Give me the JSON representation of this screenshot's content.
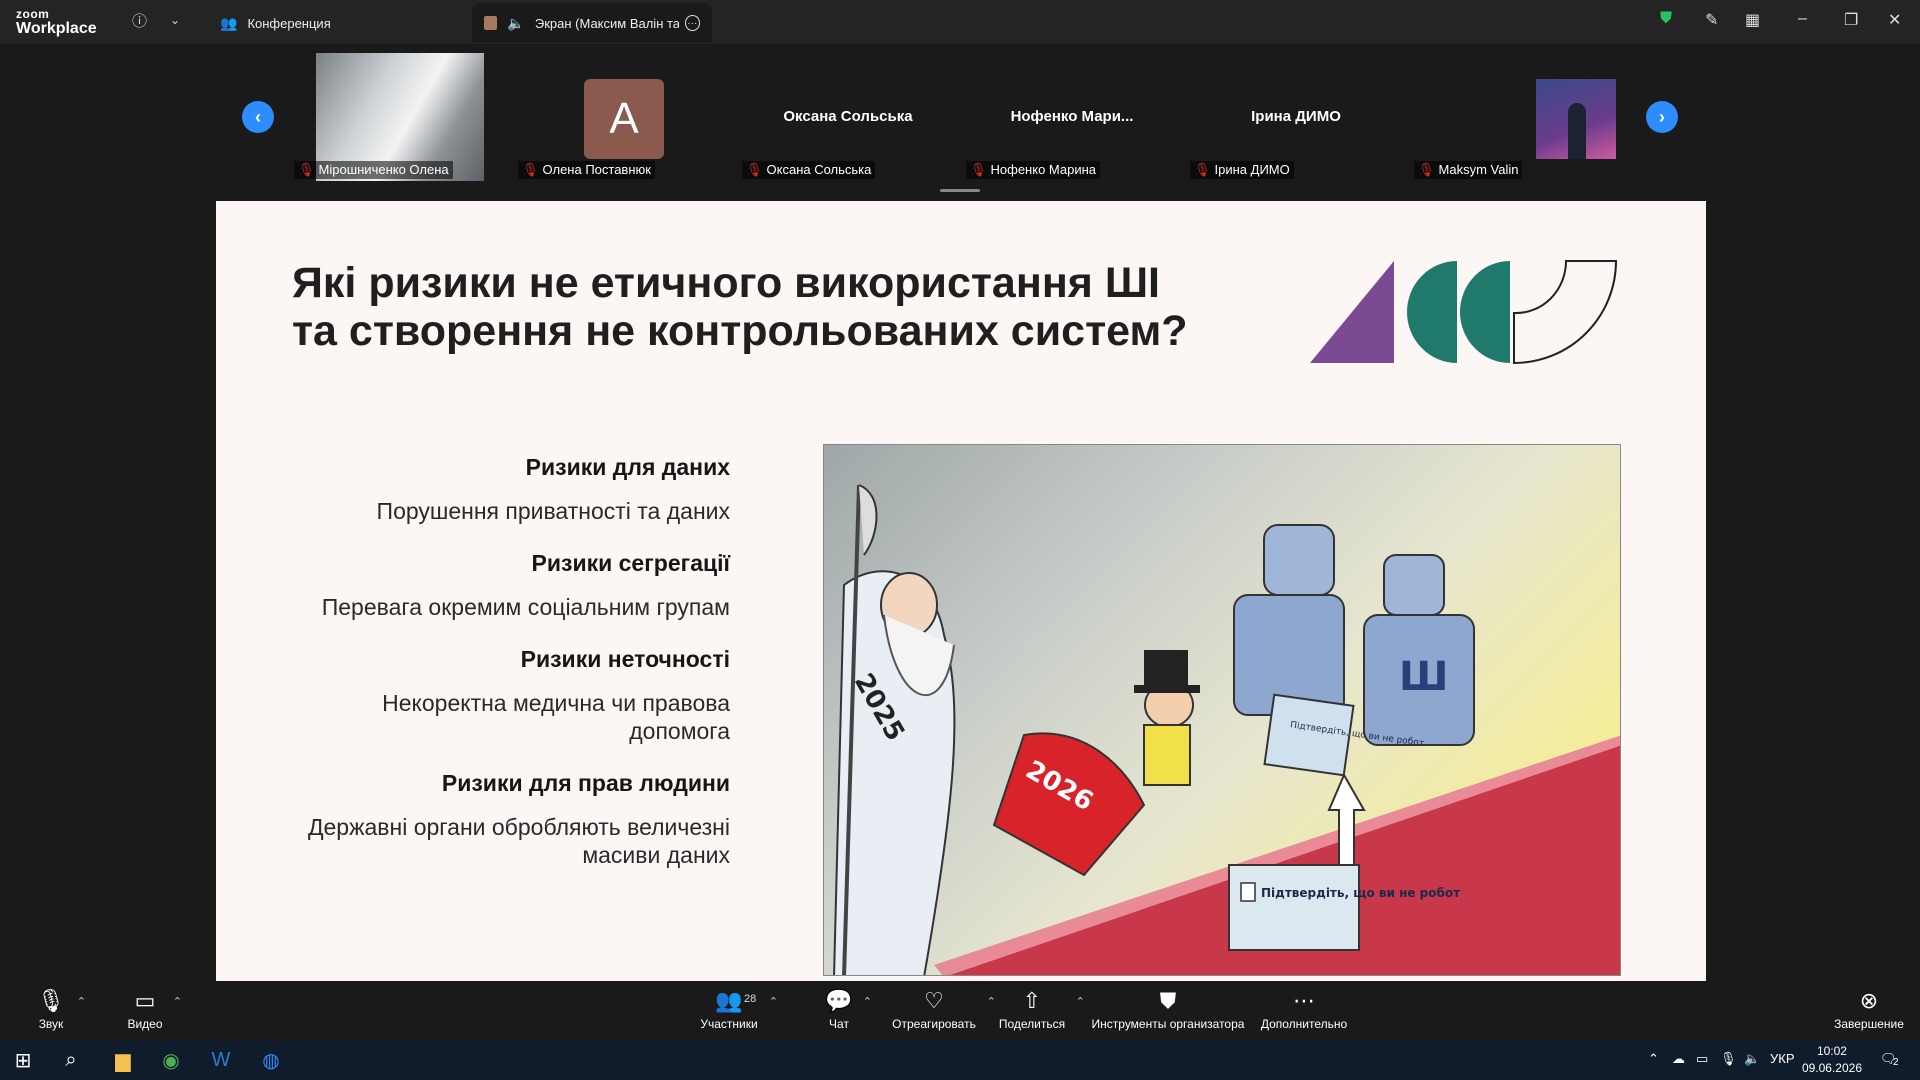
{
  "titlebar": {
    "logo_small": "zoom",
    "logo_large": "Workplace",
    "tab_conference": "Конференция",
    "tab_screen": "Экран (Максим Валін та Вас"
  },
  "participants": [
    {
      "name": "Мірошниченко Олена",
      "muted": true
    },
    {
      "name": "Олена Поставнюк",
      "muted": true,
      "avatar_letter": "A"
    },
    {
      "name": "Оксана Сольська",
      "muted": true,
      "center_name": "Оксана Сольська"
    },
    {
      "name": "Нофенко Марина",
      "muted": true,
      "center_name": "Нофенко  Мари..."
    },
    {
      "name": "Ірина ДИМО",
      "muted": true,
      "center_name": "Ірина ДИМО"
    },
    {
      "name": "Maksym Valin",
      "muted": true
    }
  ],
  "slide": {
    "title": "Які ризики не етичного використання ШІ та створення не контрольованих систем?",
    "risks": [
      {
        "heading": "Ризики для даних",
        "desc": "Порушення приватності та даних"
      },
      {
        "heading": "Ризики сегрегації",
        "desc": "Перевага окремим соціальним групам"
      },
      {
        "heading": "Ризики неточності",
        "desc": "Некоректна медична чи правова допомога"
      },
      {
        "heading": "Ризики для прав людини",
        "desc": "Державні органи обробляють величезні масиви даних"
      }
    ],
    "cartoon": {
      "year_old": "2025",
      "year_new": "2026",
      "robot_letter": "Ш",
      "captcha_big": "Підтвердіть, що ви не робот",
      "captcha_small": "Підтвердіть, що ви не робот"
    },
    "logo_colors": {
      "purple": "#7b4a93",
      "teal": "#1f7a6b",
      "outline": "#222222"
    }
  },
  "toolbar": {
    "audio": "Звук",
    "video": "Видео",
    "participants": "Участники",
    "participants_count": "28",
    "chat": "Чат",
    "react": "Отреагировать",
    "share": "Поделиться",
    "host_tools": "Инструменты организатора",
    "more": "Дополнительно",
    "end": "Завершение"
  },
  "taskbar": {
    "lang": "УКР",
    "time": "10:02",
    "date": "09.06.2026",
    "notifications": "2"
  }
}
